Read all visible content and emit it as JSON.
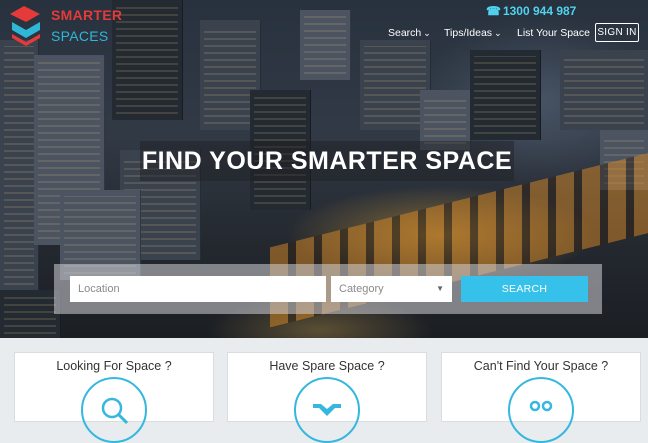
{
  "brand": {
    "line1": "SMARTER",
    "line2": "SPACES"
  },
  "header": {
    "phone": "1300 944 987",
    "nav": [
      {
        "label": "Search",
        "chevron": true
      },
      {
        "label": "Tips/Ideas",
        "chevron": true
      },
      {
        "label": "List Your Space",
        "chevron": false
      }
    ],
    "signin": "SIGN IN"
  },
  "hero": {
    "title": "FIND YOUR SMARTER SPACE"
  },
  "search": {
    "location_placeholder": "Location",
    "category_value": "Category",
    "button": "SEARCH"
  },
  "cards": [
    {
      "title": "Looking For Space ?",
      "icon": "magnifier-icon"
    },
    {
      "title": "Have Spare Space ?",
      "icon": "handshake-icon"
    },
    {
      "title": "Can't Find Your Space ?",
      "icon": "people-icon"
    }
  ],
  "colors": {
    "accent": "#35c1ea",
    "brand_red": "#e53a3a",
    "brand_blue": "#2fb7d8",
    "icon_ring": "#35b7df"
  }
}
